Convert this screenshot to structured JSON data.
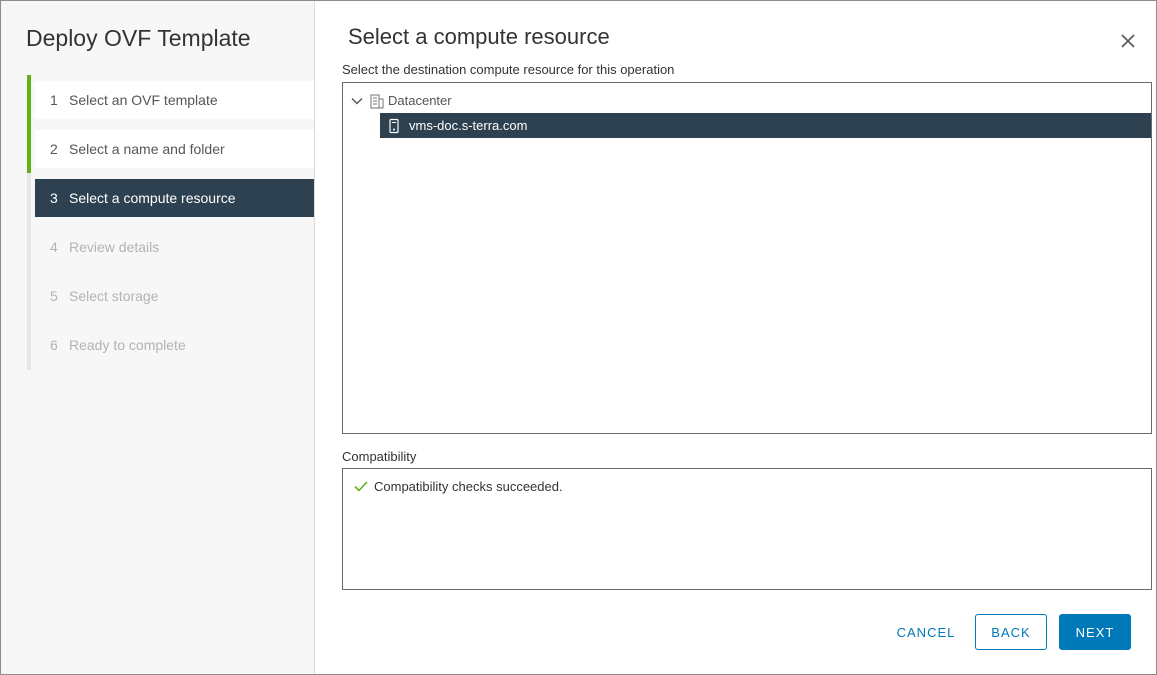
{
  "wizard": {
    "title": "Deploy OVF Template",
    "steps": [
      {
        "num": "1",
        "label": "Select an OVF template",
        "state": "done"
      },
      {
        "num": "2",
        "label": "Select a name and folder",
        "state": "done"
      },
      {
        "num": "3",
        "label": "Select a compute resource",
        "state": "active"
      },
      {
        "num": "4",
        "label": "Review details",
        "state": "pending"
      },
      {
        "num": "5",
        "label": "Select storage",
        "state": "pending"
      },
      {
        "num": "6",
        "label": "Ready to complete",
        "state": "pending"
      }
    ]
  },
  "page": {
    "title": "Select a compute resource",
    "description": "Select the destination compute resource for this operation"
  },
  "tree": {
    "root": {
      "label": "Datacenter",
      "icon": "datacenter-icon",
      "expanded": true
    },
    "child": {
      "label": "vms-doc.s-terra.com",
      "icon": "host-icon",
      "selected": true
    }
  },
  "compatibility": {
    "label": "Compatibility",
    "message": "Compatibility checks succeeded.",
    "icon": "check-icon"
  },
  "buttons": {
    "cancel": "CANCEL",
    "back": "BACK",
    "next": "NEXT"
  },
  "colors": {
    "accent": "#0079b8",
    "selected": "#2d4150",
    "progress": "#60b515",
    "success": "#60b515"
  }
}
